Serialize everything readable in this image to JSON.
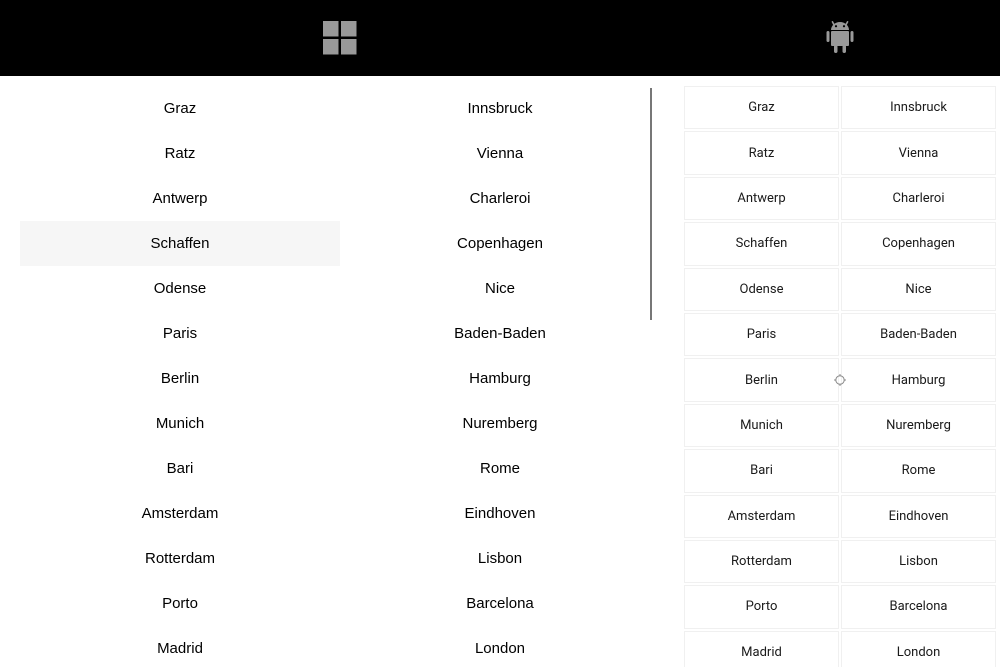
{
  "platforms": {
    "windows": {
      "name": "Windows"
    },
    "android": {
      "name": "Android"
    }
  },
  "cities": {
    "col1": [
      "Graz",
      "Ratz",
      "Antwerp",
      "Schaffen",
      "Odense",
      "Paris",
      "Berlin",
      "Munich",
      "Bari",
      "Amsterdam",
      "Rotterdam",
      "Porto",
      "Madrid"
    ],
    "col2": [
      "Innsbruck",
      "Vienna",
      "Charleroi",
      "Copenhagen",
      "Nice",
      "Baden-Baden",
      "Hamburg",
      "Nuremberg",
      "Rome",
      "Eindhoven",
      "Lisbon",
      "Barcelona",
      "London"
    ]
  },
  "windows_highlight_index": 3,
  "android_target_row": 6
}
